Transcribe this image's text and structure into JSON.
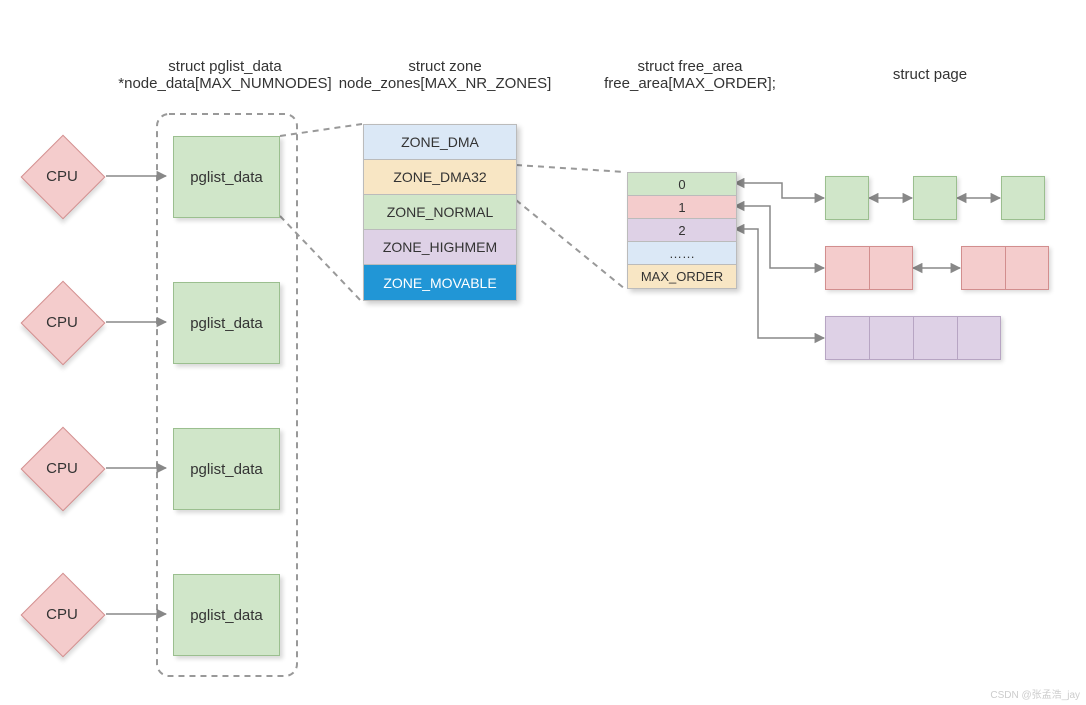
{
  "headers": {
    "pglist": {
      "line1": "struct pglist_data",
      "line2": "*node_data[MAX_NUMNODES]"
    },
    "zone": {
      "line1": "struct zone",
      "line2": "node_zones[MAX_NR_ZONES]"
    },
    "free": {
      "line1": "struct free_area",
      "line2": "free_area[MAX_ORDER];"
    },
    "page": {
      "line1": "struct page"
    }
  },
  "cpu_label": "CPU",
  "pglist_label": "pglist_data",
  "zones": [
    "ZONE_DMA",
    "ZONE_DMA32",
    "ZONE_NORMAL",
    "ZONE_HIGHMEM",
    "ZONE_MOVABLE"
  ],
  "free_area": [
    "0",
    "1",
    "2",
    "……",
    "MAX_ORDER"
  ],
  "watermark": "CSDN @张孟浩_jay"
}
